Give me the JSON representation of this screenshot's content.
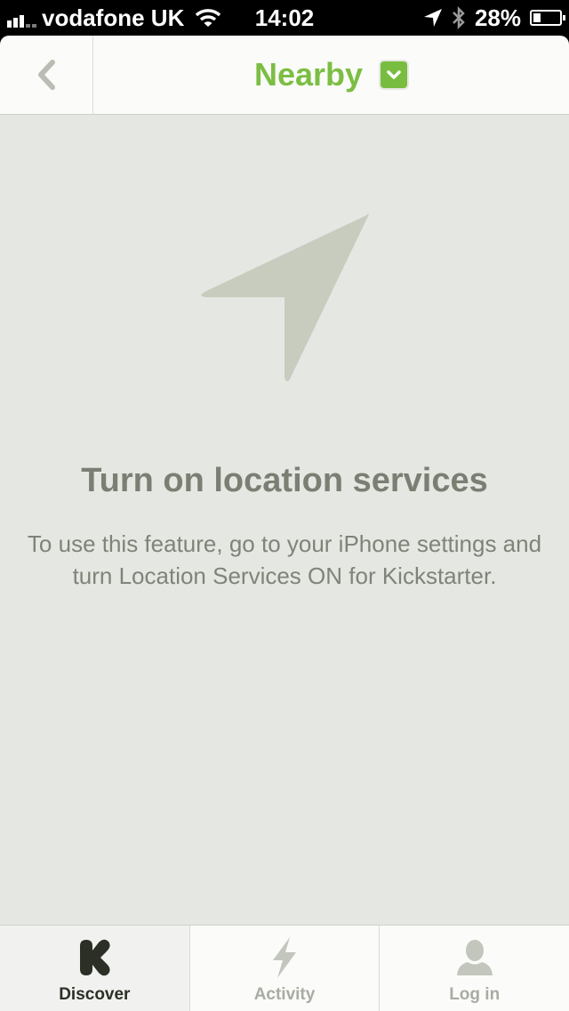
{
  "status_bar": {
    "carrier": "vodafone UK",
    "time": "14:02",
    "battery": "28%",
    "battery_level": 0.28,
    "icons": [
      "signal-icon",
      "wifi-icon",
      "location-arrow-icon",
      "bluetooth-icon",
      "battery-icon"
    ]
  },
  "nav": {
    "title": "Nearby",
    "back_icon": "chevron-left-icon",
    "dropdown_icon": "chevron-down-icon"
  },
  "empty_state": {
    "icon": "location-arrow-icon",
    "title": "Turn on location services",
    "body": "To use this feature, go to your iPhone settings and turn Location Services ON for Kickstarter."
  },
  "tabs": [
    {
      "label": "Discover",
      "icon": "kickstarter-k-icon",
      "active": true
    },
    {
      "label": "Activity",
      "icon": "lightning-icon",
      "active": false
    },
    {
      "label": "Log in",
      "icon": "user-icon",
      "active": false
    }
  ],
  "colors": {
    "accent_green": "#78bd3f",
    "nav_text_green": "#7cbe43",
    "background": "#e5e7e2",
    "icon_muted": "#c7ccbf",
    "text_muted": "#7b7f73",
    "tab_active_text": "#2b2f26",
    "tab_inactive_text": "#a8aca2"
  }
}
